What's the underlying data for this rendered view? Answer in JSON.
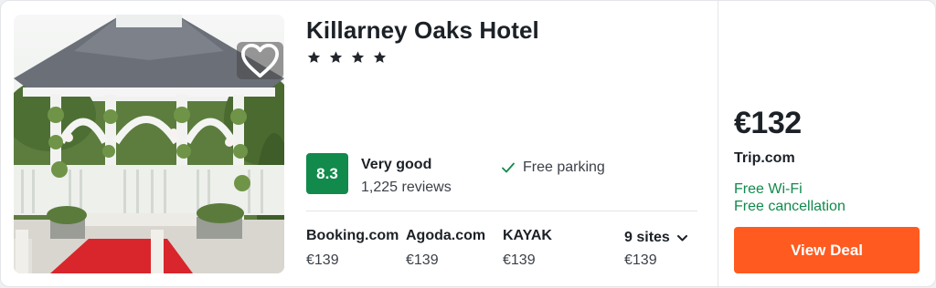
{
  "hotel": {
    "name": "Killarney Oaks Hotel",
    "star_rating": 4
  },
  "rating": {
    "score": "8.3",
    "label": "Very good",
    "reviews": "1,225 reviews"
  },
  "amenities": [
    {
      "label": "Free parking",
      "icon": "check-icon"
    }
  ],
  "other_sites": [
    {
      "name": "Booking.com",
      "price": "€139"
    },
    {
      "name": "Agoda.com",
      "price": "€139"
    },
    {
      "name": "KAYAK",
      "price": "€139"
    }
  ],
  "more_sites": {
    "label": "9 sites",
    "price": "€139",
    "icon": "chevron-down-icon"
  },
  "deal": {
    "price": "€132",
    "provider": "Trip.com",
    "perks": [
      "Free Wi-Fi",
      "Free cancellation"
    ],
    "button_label": "View Deal"
  },
  "icons": {
    "favorite": "heart-outline-icon",
    "star": "star-icon"
  },
  "colors": {
    "rating_badge": "#118a4c",
    "perk_text": "#118a4c",
    "deal_button": "#ff5a1f"
  }
}
